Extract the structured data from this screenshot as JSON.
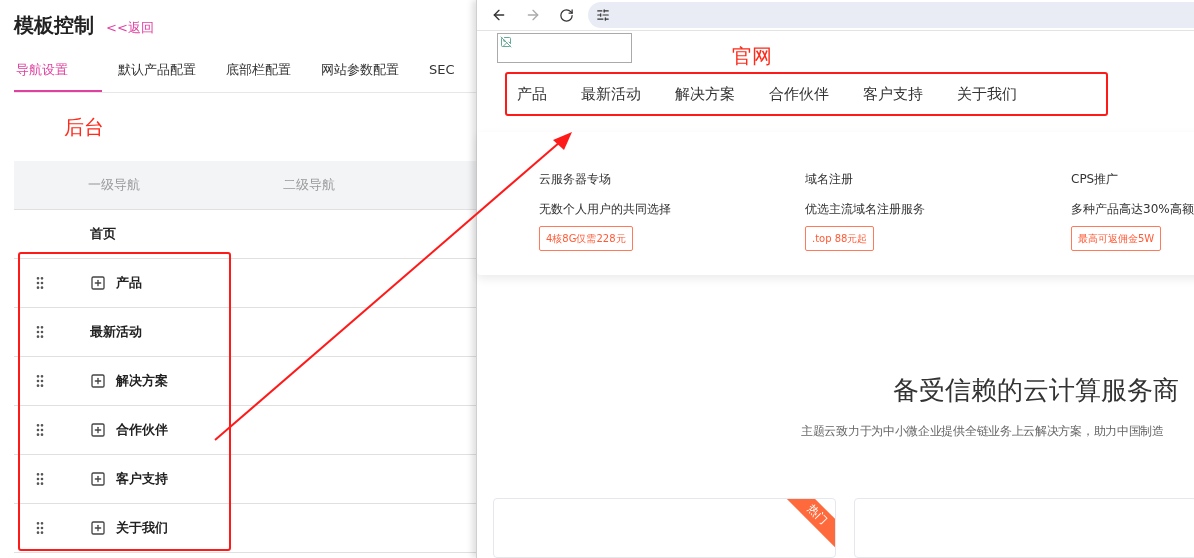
{
  "admin": {
    "title": "模板控制",
    "back_link": "<<返回",
    "tabs": [
      {
        "label": "导航设置",
        "selected": true
      },
      {
        "label": "默认产品配置",
        "selected": false
      },
      {
        "label": "底部栏配置",
        "selected": false
      },
      {
        "label": "网站参数配置",
        "selected": false
      },
      {
        "label": "SEC",
        "selected": false
      }
    ],
    "annotation": "后台",
    "table": {
      "columns": [
        "一级导航",
        "二级导航"
      ],
      "rows": [
        {
          "label": "首页",
          "draggable": false,
          "expandable": false
        },
        {
          "label": "产品",
          "draggable": true,
          "expandable": true
        },
        {
          "label": "最新活动",
          "draggable": true,
          "expandable": false
        },
        {
          "label": "解决方案",
          "draggable": true,
          "expandable": true
        },
        {
          "label": "合作伙伴",
          "draggable": true,
          "expandable": true
        },
        {
          "label": "客户支持",
          "draggable": true,
          "expandable": true
        },
        {
          "label": "关于我们",
          "draggable": true,
          "expandable": true
        }
      ]
    }
  },
  "browser": {
    "annotation": "官网",
    "nav": [
      "产品",
      "最新活动",
      "解决方案",
      "合作伙伴",
      "客户支持",
      "关于我们"
    ],
    "promos": [
      {
        "title": "云服务器专场",
        "subtitle": "无数个人用户的共同选择",
        "badge": "4核8G仅需228元"
      },
      {
        "title": "域名注册",
        "subtitle": "优选主流域名注册服务",
        "badge": ".top 88元起"
      },
      {
        "title": "CPS推广",
        "subtitle": "多种产品高达30%高额",
        "badge": "最高可返佣金5W"
      }
    ],
    "hero": {
      "title": "备受信赖的云计算服务商",
      "subtitle": "主题云致力于为中小微企业提供全链业务上云解决方案，助力中国制造"
    },
    "cards": [
      {
        "ribbon": "热门"
      }
    ]
  }
}
